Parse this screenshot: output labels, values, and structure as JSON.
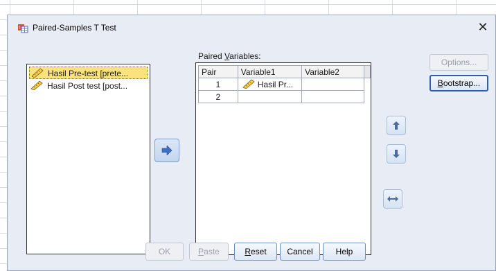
{
  "window": {
    "title": "Paired-Samples T Test",
    "close_glyph": "✕"
  },
  "source_list": {
    "items": [
      {
        "label": "Hasil Pre-test [prete...",
        "selected": true,
        "icon": "scale-ruler-icon"
      },
      {
        "label": "Hasil Post test [post...",
        "selected": false,
        "icon": "scale-ruler-icon"
      }
    ]
  },
  "paired": {
    "label_before": "Paired ",
    "label_accel": "V",
    "label_after": "ariables:",
    "headers": [
      "Pair",
      "Variable1",
      "Variable2"
    ],
    "rows": [
      {
        "pair": "1",
        "variable1": "Hasil Pr...",
        "variable2": ""
      },
      {
        "pair": "2",
        "variable1": "",
        "variable2": ""
      }
    ]
  },
  "buttons": {
    "options": "Options...",
    "bootstrap": "Bootstrap...",
    "ok": "OK",
    "paste": "Paste",
    "reset": "Reset",
    "cancel": "Cancel",
    "help": "Help"
  },
  "icons": {
    "move_right": "arrow-right-icon",
    "move_up": "arrow-up-icon",
    "move_down": "arrow-down-icon",
    "swap": "swap-horizontal-icon"
  },
  "colors": {
    "dialog_bg": "#e8ecf5",
    "selection": "#fbe27a",
    "accent_border": "#2a5fb3"
  }
}
